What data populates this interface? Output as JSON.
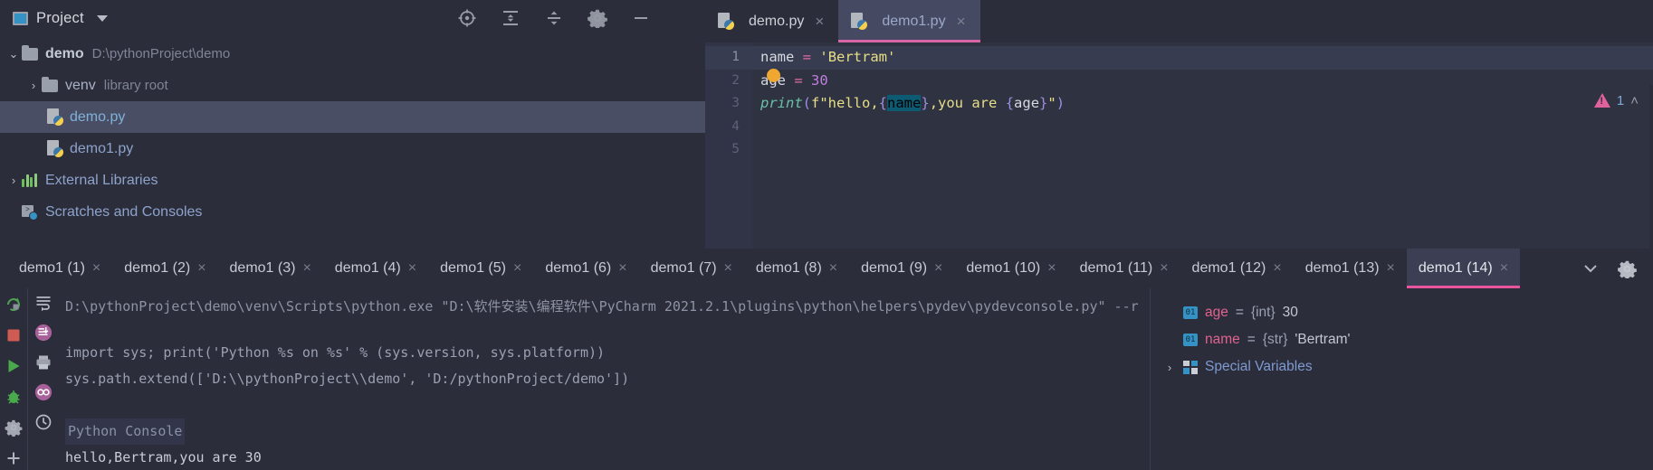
{
  "project_panel": {
    "title": "Project",
    "dropdown_icon": "chevron-down-icon",
    "toolbar_icons": [
      "locate-target-icon",
      "expand-all-icon",
      "collapse-all-icon",
      "settings-gear-icon",
      "minimize-icon"
    ],
    "tree": [
      {
        "arrow": "⌄",
        "icon": "folder-icon",
        "name": "demo",
        "bold": true,
        "path": "D:\\pythonProject\\demo",
        "selected": false,
        "indent": 0
      },
      {
        "arrow": "›",
        "icon": "folder-icon",
        "name": "venv",
        "bold": false,
        "tag": "library root",
        "selected": false,
        "indent": 1
      },
      {
        "arrow": "",
        "icon": "python-file-icon",
        "name": "demo.py",
        "pyfile": true,
        "selected": true,
        "indent": 2
      },
      {
        "arrow": "",
        "icon": "python-file-icon",
        "name": "demo1.py",
        "pyfile": true,
        "selected": false,
        "indent": 2
      },
      {
        "arrow": "›",
        "icon": "external-libraries-icon",
        "name": "External Libraries",
        "linkish": true,
        "selected": false,
        "indent": 0
      },
      {
        "arrow": "",
        "icon": "scratches-icon",
        "name": "Scratches and Consoles",
        "linkish": true,
        "selected": false,
        "indent": 0
      }
    ]
  },
  "editor": {
    "tabs": [
      {
        "label": "demo.py",
        "icon": "python-file-icon",
        "close": "×",
        "active": false
      },
      {
        "label": "demo1.py",
        "icon": "python-file-icon",
        "close": "×",
        "active": true
      }
    ],
    "gutter_lines": [
      "1",
      "2",
      "3",
      "4",
      "5"
    ],
    "code_lines": [
      {
        "n": 1,
        "current": true,
        "tokens": [
          {
            "t": "name",
            "c": "k-var"
          },
          {
            "t": " ",
            "c": "k-var"
          },
          {
            "t": "=",
            "c": "k-op"
          },
          {
            "t": " ",
            "c": "k-var"
          },
          {
            "t": "'Bertram'",
            "c": "k-str"
          }
        ]
      },
      {
        "n": 2,
        "current": false,
        "tokens": [
          {
            "t": "age",
            "c": "k-var"
          },
          {
            "t": " ",
            "c": "k-var"
          },
          {
            "t": "=",
            "c": "k-op"
          },
          {
            "t": " ",
            "c": "k-var"
          },
          {
            "t": "30",
            "c": "k-num"
          }
        ]
      },
      {
        "n": 3,
        "current": false,
        "tokens": [
          {
            "t": "print",
            "c": "k-fn"
          },
          {
            "t": "(",
            "c": "k-paren"
          },
          {
            "t": "f\"hello,",
            "c": "k-str"
          },
          {
            "t": "{",
            "c": "k-brace"
          },
          {
            "t": "name",
            "c": "k-hl"
          },
          {
            "t": "}",
            "c": "k-brace"
          },
          {
            "t": ",you are ",
            "c": "k-str"
          },
          {
            "t": "{",
            "c": "k-brace"
          },
          {
            "t": "age",
            "c": "k-inner"
          },
          {
            "t": "}",
            "c": "k-brace"
          },
          {
            "t": "\"",
            "c": "k-str"
          },
          {
            "t": ")",
            "c": "k-paren"
          }
        ]
      },
      {
        "n": 4,
        "current": false,
        "tokens": []
      },
      {
        "n": 5,
        "current": false,
        "tokens": []
      }
    ],
    "breakpoint_marker": "breakpoint-dot",
    "warning": {
      "icon": "warning-triangle-icon",
      "count": "1",
      "chevron": "˄"
    }
  },
  "console_tabs": {
    "items": [
      {
        "label": "demo1 (1)",
        "close": "×",
        "active": false
      },
      {
        "label": "demo1 (2)",
        "close": "×",
        "active": false
      },
      {
        "label": "demo1 (3)",
        "close": "×",
        "active": false
      },
      {
        "label": "demo1 (4)",
        "close": "×",
        "active": false
      },
      {
        "label": "demo1 (5)",
        "close": "×",
        "active": false
      },
      {
        "label": "demo1 (6)",
        "close": "×",
        "active": false
      },
      {
        "label": "demo1 (7)",
        "close": "×",
        "active": false
      },
      {
        "label": "demo1 (8)",
        "close": "×",
        "active": false
      },
      {
        "label": "demo1 (9)",
        "close": "×",
        "active": false
      },
      {
        "label": "demo1 (10)",
        "close": "×",
        "active": false
      },
      {
        "label": "demo1 (11)",
        "close": "×",
        "active": false
      },
      {
        "label": "demo1 (12)",
        "close": "×",
        "active": false
      },
      {
        "label": "demo1 (13)",
        "close": "×",
        "active": false
      },
      {
        "label": "demo1 (14)",
        "close": "×",
        "active": true
      }
    ],
    "overflow_icon": "chevron-down-icon",
    "settings_icon": "settings-gear-icon"
  },
  "run_toolbar": {
    "icons": [
      "rerun-icon",
      "stop-icon",
      "run-icon",
      "debug-icon",
      "settings-gear-icon",
      "add-icon"
    ]
  },
  "console_gutter": {
    "icons": [
      "soft-wrap-icon",
      "scroll-to-end-icon",
      "print-icon",
      "show-variables-icon",
      "history-icon"
    ]
  },
  "console_output": {
    "lines": [
      {
        "text": "D:\\pythonProject\\demo\\venv\\Scripts\\python.exe \"D:\\软件安装\\编程软件\\PyCharm 2021.2.1\\plugins\\python\\helpers\\pydev\\pydevconsole.py\" --r",
        "kind": "dim"
      },
      {
        "text": "",
        "kind": "dim"
      },
      {
        "text": "import sys; print('Python %s on %s' % (sys.version, sys.platform))",
        "kind": "sys"
      },
      {
        "text": "sys.path.extend(['D:\\\\pythonProject\\\\demo', 'D:/pythonProject/demo'])",
        "kind": "sys"
      },
      {
        "text": "",
        "kind": "sys"
      },
      {
        "text": "Python Console",
        "kind": "hdr"
      },
      {
        "text": "hello,Bertram,you are 30",
        "kind": "out"
      }
    ]
  },
  "variables": {
    "rows": [
      {
        "arrow": "",
        "icon": "value-icon",
        "icon_text": "01",
        "name": "age",
        "eq": " = ",
        "type": "{int}",
        "value": "30",
        "special": false
      },
      {
        "arrow": "",
        "icon": "value-icon",
        "icon_text": "01",
        "name": "name",
        "eq": " = ",
        "type": "{str}",
        "value": "'Bertram'",
        "special": false
      },
      {
        "arrow": "›",
        "icon": "special-variables-icon",
        "label": "Special Variables",
        "special": true
      }
    ]
  },
  "colors": {
    "background": "#2b2d3a",
    "editor_bg": "#2f3241",
    "selection": "#4a4e64",
    "accent_pink": "#e8559e",
    "warning_pink": "#e0629b",
    "string_yellow": "#e7df87",
    "number_purple": "#c17fe0",
    "function_teal": "#6cc0a8",
    "breakpoint_orange": "#f0a732",
    "var_name_pink": "#e0628f",
    "link_blue": "#7e9ad0"
  }
}
